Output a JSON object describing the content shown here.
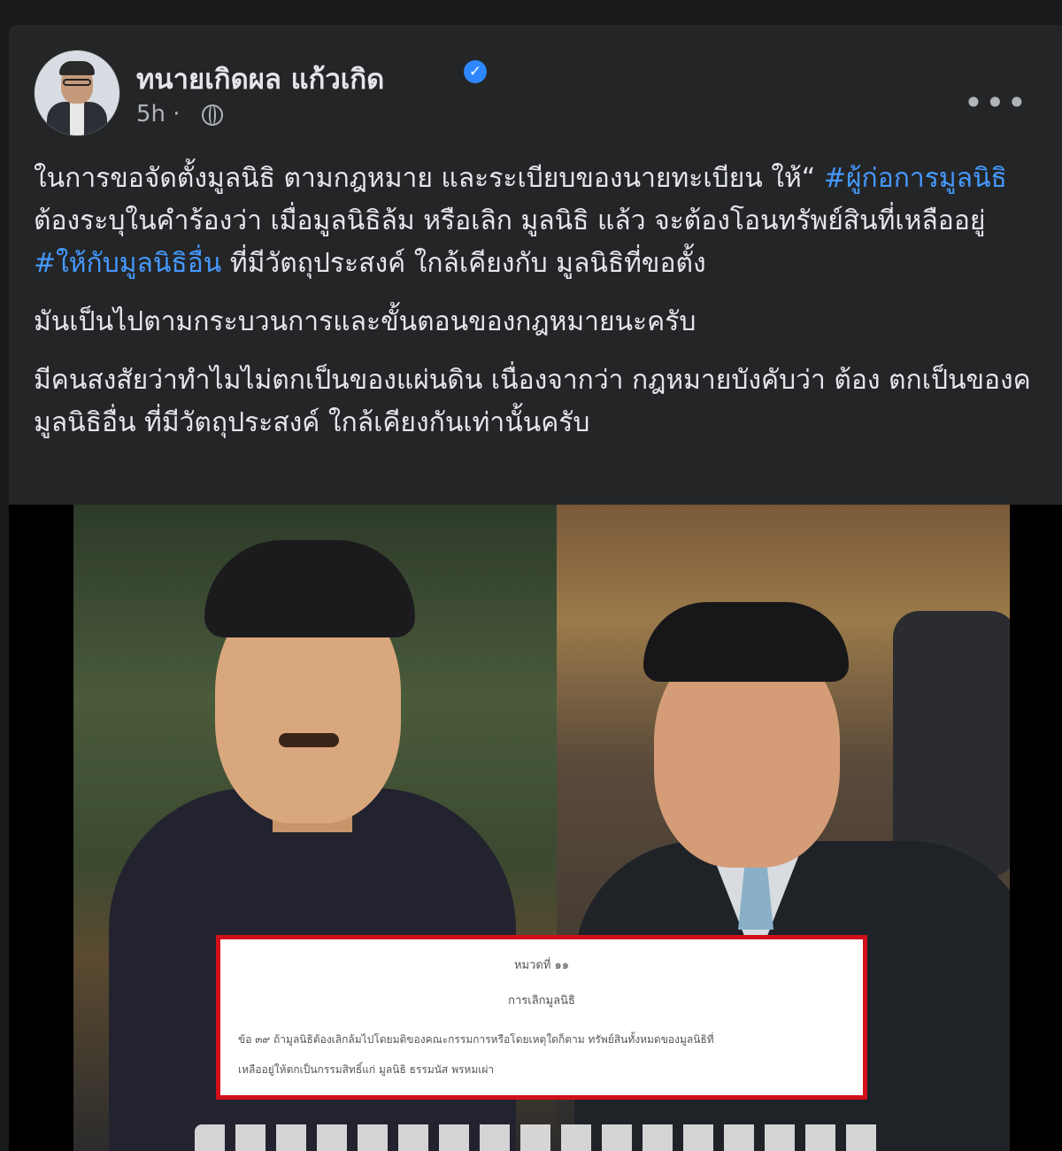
{
  "post": {
    "author": "ทนายเกิดผล แก้วเกิด",
    "verified_icon": "verified-badge-icon",
    "time": "5h ·",
    "audience_icon": "globe-icon",
    "more_label": "•••",
    "text": {
      "p1_before_tag1": "ในการขอจัดตั้งมูลนิธิ  ตามกฎหมาย และระเบียบของนายทะเบียน ให้“ ",
      "tag1": "#ผู้ก่อการมูลนิธิ",
      "p1_mid": " ต้องระบุในคำร้องว่า เมื่อมูลนิธิล้ม หรือเลิก มูลนิธิ แล้ว จะต้องโอนทรัพย์สินที่เหลืออยู่ ",
      "tag2": "#ให้กับมูลนิธิอื่น",
      "p1_after": " ที่มีวัตถุประสงค์ ใกล้เคียงกับ มูลนิธิที่ขอตั้ง",
      "p2": "มันเป็นไปตามกระบวนการและขั้นตอนของกฎหมายนะครับ",
      "p3": "มีคนสงสัยว่าทำไมไม่ตกเป็นของแผ่นดิน เนื่องจากว่า กฎหมายบังคับว่า ต้อง ตกเป็นของค มูลนิธิอื่น ที่มีวัตถุประสงค์ ใกล้เคียงกันเท่านั้นครับ"
    }
  },
  "image": {
    "document": {
      "heading1": "หมวดที่ ๑๑",
      "heading2": "การเลิกมูลนิธิ",
      "line1": "ข้อ ๓๙   ถ้ามูลนิธิต้องเลิกล้มไปโดยมติของคณะกรรมการหรือโดยเหตุใดก็ตาม ทรัพย์สินทั้งหมดของมูลนิธิที่",
      "line2": "เหลืออยู่ให้ตกเป็นกรรมสิทธิ์แก่ มูลนิธิ ธรรมนัส พรหมเผ่า"
    }
  },
  "colors": {
    "background": "#18191a",
    "card": "#242526",
    "text": "#e4e6eb",
    "secondary": "#b0b3b8",
    "hashtag": "#4599ff",
    "verified": "#2d88ff",
    "doc_border": "#d10f1a"
  }
}
